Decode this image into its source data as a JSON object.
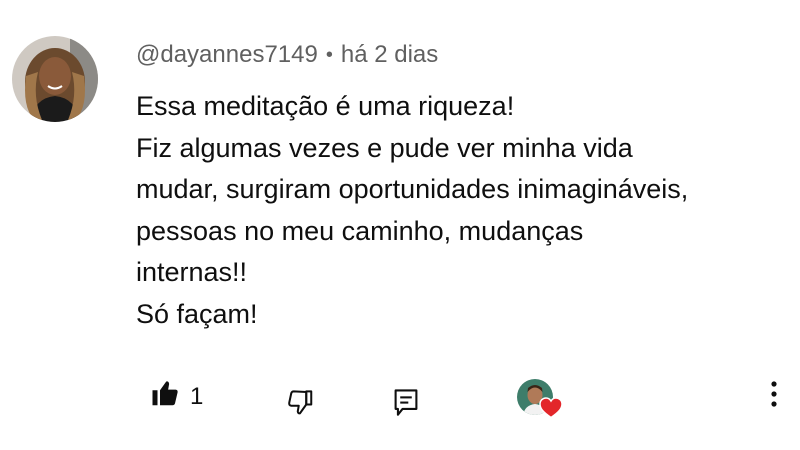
{
  "comment": {
    "author": "@dayannes7149",
    "separator": "•",
    "timestamp": "há 2 dias",
    "lines": [
      "Essa meditação é uma riqueza!",
      "Fiz algumas vezes e pude ver minha vida",
      "mudar, surgiram oportunidades inimagináveis,",
      "pessoas no meu caminho, mudanças",
      "internas!!",
      "Só façam!"
    ]
  },
  "actions": {
    "like_count": "1",
    "like_icon": "thumbs-up-filled-icon",
    "dislike_icon": "thumbs-down-icon",
    "reply_icon": "reply-comment-icon",
    "creator_heart_icon": "creator-heart-icon",
    "more_icon": "more-vertical-icon"
  },
  "colors": {
    "text": "#0f0f0f",
    "meta": "#606060",
    "heart": "#e3262a"
  }
}
